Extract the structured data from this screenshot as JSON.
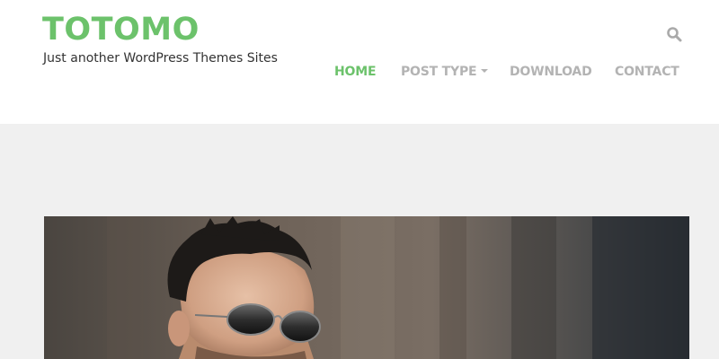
{
  "site": {
    "title": "TOTOMO",
    "tagline": "Just another WordPress Themes Sites"
  },
  "header": {
    "search_icon": "search-icon"
  },
  "nav": {
    "items": [
      {
        "label": "HOME",
        "active": true
      },
      {
        "label": "POST TYPE",
        "has_dropdown": true
      },
      {
        "label": "DOWNLOAD"
      },
      {
        "label": "CONTACT"
      }
    ]
  },
  "colors": {
    "brand": "#6cc26b",
    "nav_inactive": "#b3b3b3",
    "tagline": "#333333",
    "page_bg": "#f0f0f0",
    "header_bg": "#ffffff",
    "search_icon": "#aaaaaa"
  },
  "hero": {
    "image": "man-with-aviator-sunglasses-photo"
  }
}
